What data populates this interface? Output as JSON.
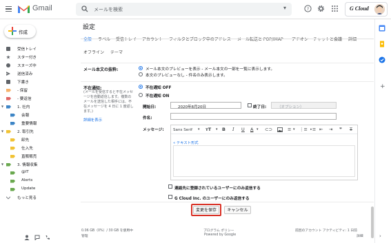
{
  "app": {
    "name": "Gmail"
  },
  "search": {
    "placeholder": "メールを検索"
  },
  "account": {
    "brand": "G Cloud"
  },
  "compose": {
    "label": "作成"
  },
  "sidebar": {
    "items": [
      {
        "label": "受信トレイ",
        "icon": "inbox-icon"
      },
      {
        "label": "スター付き",
        "icon": "star-icon"
      },
      {
        "label": "スヌーズ中",
        "icon": "clock-icon"
      },
      {
        "label": "送信済み",
        "icon": "send-icon"
      },
      {
        "label": "下書き",
        "icon": "draft-icon"
      },
      {
        "label": "- 保留",
        "icon": "label-icon",
        "color": "#f6b26b"
      },
      {
        "label": "- 要返信",
        "icon": "label-icon",
        "color": "#e06666"
      },
      {
        "label": "1. 社内",
        "icon": "label-icon",
        "color": "#3d85c6"
      },
      {
        "label": "会報",
        "icon": "label-icon",
        "color": "#3d85c6"
      },
      {
        "label": "重要情報",
        "icon": "label-icon",
        "color": "#3d85c6"
      },
      {
        "label": "2. 取引先",
        "icon": "label-icon",
        "color": "#f1c232"
      },
      {
        "label": "卸先",
        "icon": "label-icon",
        "color": "#f1c232"
      },
      {
        "label": "仕入先",
        "icon": "label-icon",
        "color": "#f1c232"
      },
      {
        "label": "直販販売",
        "icon": "label-icon",
        "color": "#f1c232"
      },
      {
        "label": "3. 情報収集",
        "icon": "label-icon",
        "color": "#6aa84f"
      },
      {
        "label": "@IT",
        "icon": "label-icon",
        "color": "#6aa84f"
      },
      {
        "label": "Alerts",
        "icon": "label-icon",
        "color": "#6aa84f"
      },
      {
        "label": "Update",
        "icon": "label-icon",
        "color": "#6aa84f"
      },
      {
        "label": "もっと見る",
        "icon": "chevron-down-icon"
      }
    ]
  },
  "settings": {
    "title": "設定",
    "tabs": [
      "全般",
      "ラベル",
      "受信トレイ",
      "アカウント",
      "フィルタとブロック中のアドレス",
      "メール転送と POP/IMAP",
      "アドオン",
      "チャットと会議",
      "詳細",
      "オフライン",
      "テーマ"
    ],
    "preview": {
      "label": "メール本文の抜粋:",
      "opt_on": "メール本文のプレビューを表示 - メール本文の一部を一覧に表示します。",
      "opt_off": "本文のプレビューなし - 件名のみ表示します。"
    },
    "vacation": {
      "label": "不在通知:",
      "help": [
        "(メールを受信すると不在メッセ",
        "ージを自動返信します。複数の",
        "メールを送信した相手には、不",
        "在メッセージを 4 日に 1 度返し",
        "ます。)"
      ],
      "learn_more": "詳細を表示",
      "opt_off": "不在通知 OFF",
      "opt_on": "不在通知 ON",
      "start_label": "開始日:",
      "start_value": "2020年8月20日",
      "end_label": "終了日:",
      "end_placeholder": "（オプション）",
      "subject_label": "件名:",
      "message_label": "メッセージ:",
      "font_name": "Sans Serif",
      "plain_text": "« テキスト形式",
      "contacts_only": "連絡先に登録されているユーザーにのみ返信する",
      "domain_only": "G Cloud Inc. のユーザーにのみ返信する"
    },
    "save_label": "変更を保存",
    "cancel_label": "キャンセル"
  },
  "footer": {
    "storage": "0.06 GB（0%）/ 30 GB を使用中",
    "manage": "管理",
    "policy": "プログラム ポリシー",
    "powered": "Powered by Google",
    "activity": "前回のアカウント アクティビティ: 1 日前",
    "details": "詳細"
  },
  "colors": {
    "accent": "#1a73e8",
    "save_outline": "#d93025"
  }
}
